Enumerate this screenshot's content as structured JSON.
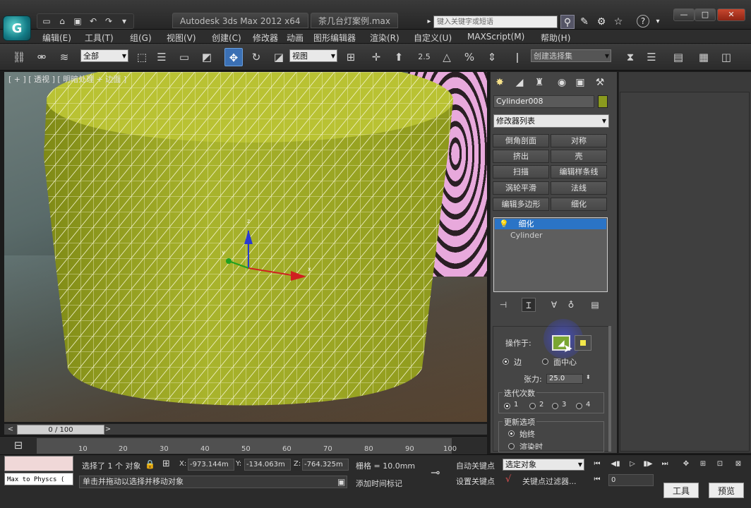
{
  "title": {
    "app_title": "Autodesk 3ds Max  2012 x64",
    "file_name": "茶几台灯案例.max",
    "search_placeholder": "键入关键字或短语",
    "help_label": "?",
    "win_minimize": "—",
    "win_restore": "□",
    "win_close": "✕"
  },
  "menu": [
    "编辑(E)",
    "工具(T)",
    "组(G)",
    "视图(V)",
    "创建(C)",
    "修改器",
    "动画",
    "图形编辑器",
    "渲染(R)",
    "自定义(U)",
    "MAXScript(M)",
    "帮助(H)"
  ],
  "toolbar": {
    "selection_filter": "全部",
    "ref_coord": "视图",
    "named_selection": "创建选择集",
    "snap_value": "2.5",
    "percent": "%"
  },
  "viewport": {
    "label": "[ + ] [ 透视 ] [ 明暗处理 + 边面 ]",
    "axis_x": "x",
    "axis_y": "y",
    "axis_z": "z"
  },
  "timeslider": {
    "frame": "0 / 100",
    "prev": "<",
    "next": ">"
  },
  "track_ticks": [
    "10",
    "20",
    "30",
    "40",
    "50",
    "60",
    "70",
    "80",
    "90",
    "100"
  ],
  "status": {
    "maxscript_text": "Max to Physcs (",
    "selected": "选择了 1 个 对象",
    "x_label": "X:",
    "x_value": "-973.144m",
    "y_label": "Y:",
    "y_value": "-134.063m",
    "z_label": "Z:",
    "z_value": "-764.325m",
    "grid": "栅格 = 10.0mm",
    "prompt": "单击并拖动以选择并移动对象",
    "add_time_tag": "添加时间标记",
    "auto_key": "自动关键点",
    "set_key": "设置关键点",
    "key_mode_select": "选定对象",
    "key_filters": "关键点过滤器...",
    "frame_value": "0",
    "tools_button": "工具",
    "preview_button": "预览"
  },
  "command_panel": {
    "object_name": "Cylinder008",
    "object_color": "#8a9a1e",
    "modifier_list": "修改器列表",
    "modifier_buttons": [
      "倒角剖面",
      "对称",
      "挤出",
      "壳",
      "扫描",
      "编辑样条线",
      "涡轮平滑",
      "法线",
      "编辑多边形",
      "细化"
    ],
    "stack": [
      {
        "label": "细化",
        "selected": true
      },
      {
        "label": "Cylinder",
        "selected": false
      }
    ],
    "rollout": {
      "operate_on": "操作于:",
      "edge": "边",
      "face_center": "面中心",
      "tension_label": "张力:",
      "tension_value": "25.0",
      "iterations_label": "迭代次数",
      "iterations": [
        "1",
        "2",
        "3",
        "4"
      ],
      "update_label": "更新选项",
      "always": "始终",
      "render_time": "渲染时"
    }
  },
  "colors": {
    "accent": "#2b74c6",
    "cylinder": "#a8b22a",
    "active_button": "#7aa632"
  }
}
